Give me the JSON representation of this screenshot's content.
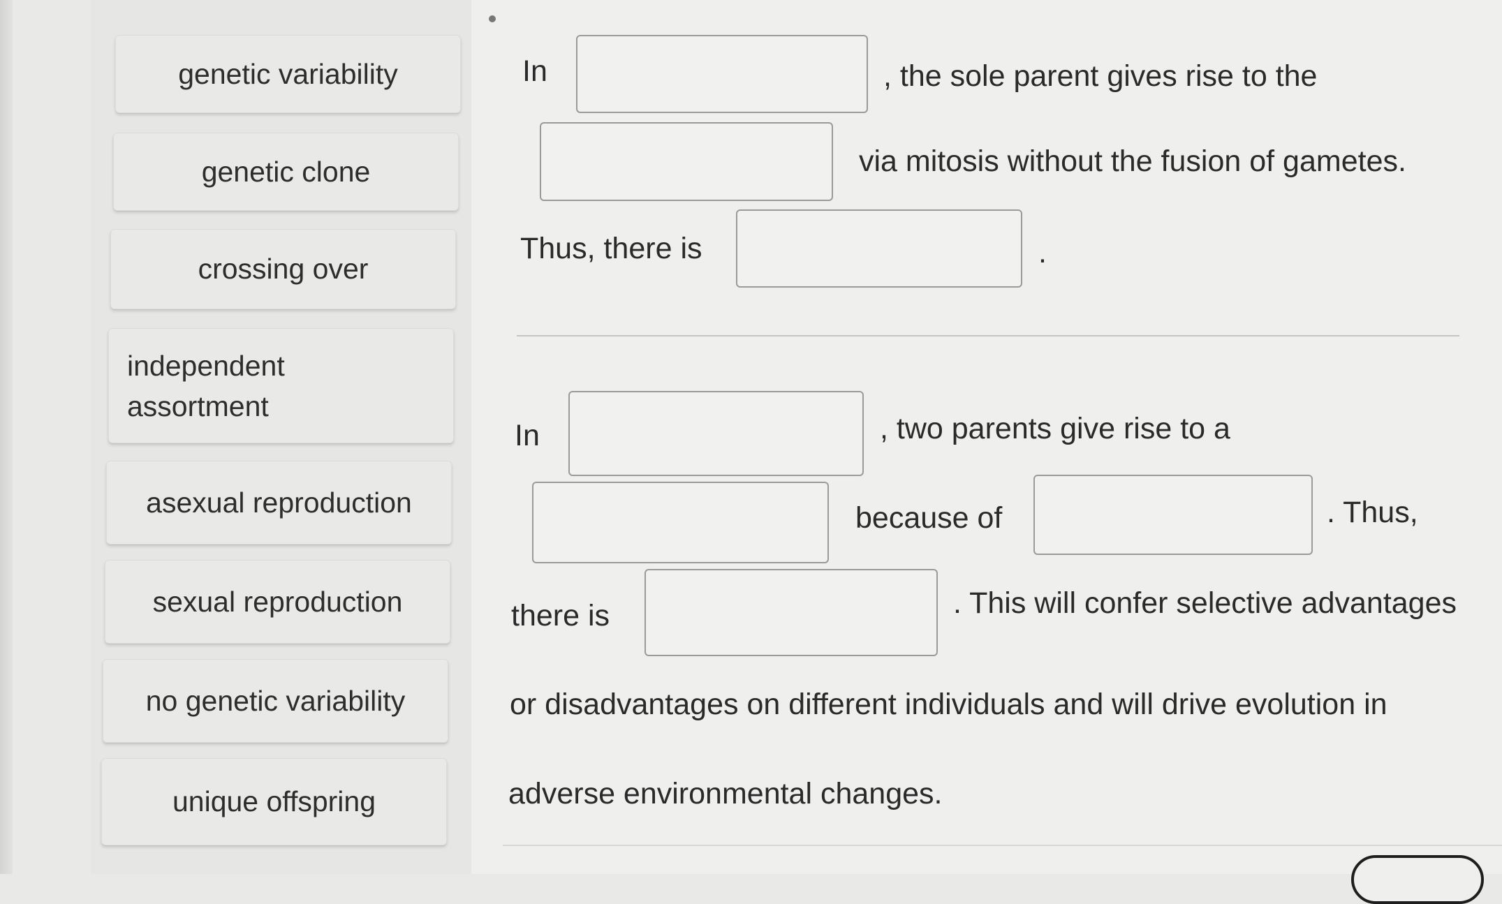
{
  "word_bank": [
    "genetic variability",
    "genetic clone",
    "crossing over",
    "independent assortment",
    "asexual reproduction",
    "sexual reproduction",
    "no genetic variability",
    "unique offspring"
  ],
  "paragraph1": {
    "t1": "In",
    "t2": ", the sole parent gives rise to the",
    "t3": "via mitosis without the fusion of gametes.",
    "t4": "Thus, there is",
    "t5": "."
  },
  "paragraph2": {
    "t1": "In",
    "t2": ", two parents give rise to a",
    "t3": "because of",
    "t4": ". Thus,",
    "t5": "there is",
    "t6": ". This will confer selective advantages",
    "t7": "or disadvantages on different individuals and will drive evolution in",
    "t8": "adverse environmental changes."
  }
}
